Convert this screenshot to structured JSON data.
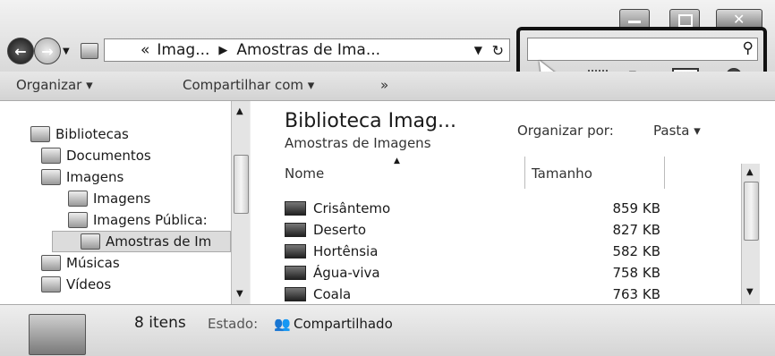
{
  "window": {
    "address": {
      "back_arrow": "«",
      "part1": "Imag...",
      "sep": "▶",
      "part2": "Amostras de Ima...",
      "dropdown": "▼",
      "refresh": "↻"
    },
    "search": {
      "placeholder": "",
      "icon": "search-icon"
    }
  },
  "toolbar": {
    "organize": "Organizar ▾",
    "share": "Compartilhar com ▾",
    "more": "»"
  },
  "sidebar": {
    "items": [
      {
        "label": "Bibliotecas"
      },
      {
        "label": "Documentos"
      },
      {
        "label": "Imagens"
      },
      {
        "label": "Imagens"
      },
      {
        "label": "Imagens Pública:"
      },
      {
        "label": "Amostras de Im"
      },
      {
        "label": "Músicas"
      },
      {
        "label": "Vídeos"
      }
    ]
  },
  "main": {
    "title": "Biblioteca Imag...",
    "subtitle": "Amostras de Imagens",
    "arrange_label": "Organizar por:",
    "arrange_value": "Pasta ▾",
    "columns": {
      "name": "Nome",
      "size": "Tamanho"
    },
    "files": [
      {
        "name": "Crisântemo",
        "size": "859 KB"
      },
      {
        "name": "Deserto",
        "size": "827 KB"
      },
      {
        "name": "Hortênsia",
        "size": "582 KB"
      },
      {
        "name": "Água-viva",
        "size": "758 KB"
      },
      {
        "name": "Coala",
        "size": "763 KB"
      }
    ]
  },
  "status": {
    "count": "8 itens",
    "state_label": "Estado:",
    "state_value": "Compartilhado"
  }
}
